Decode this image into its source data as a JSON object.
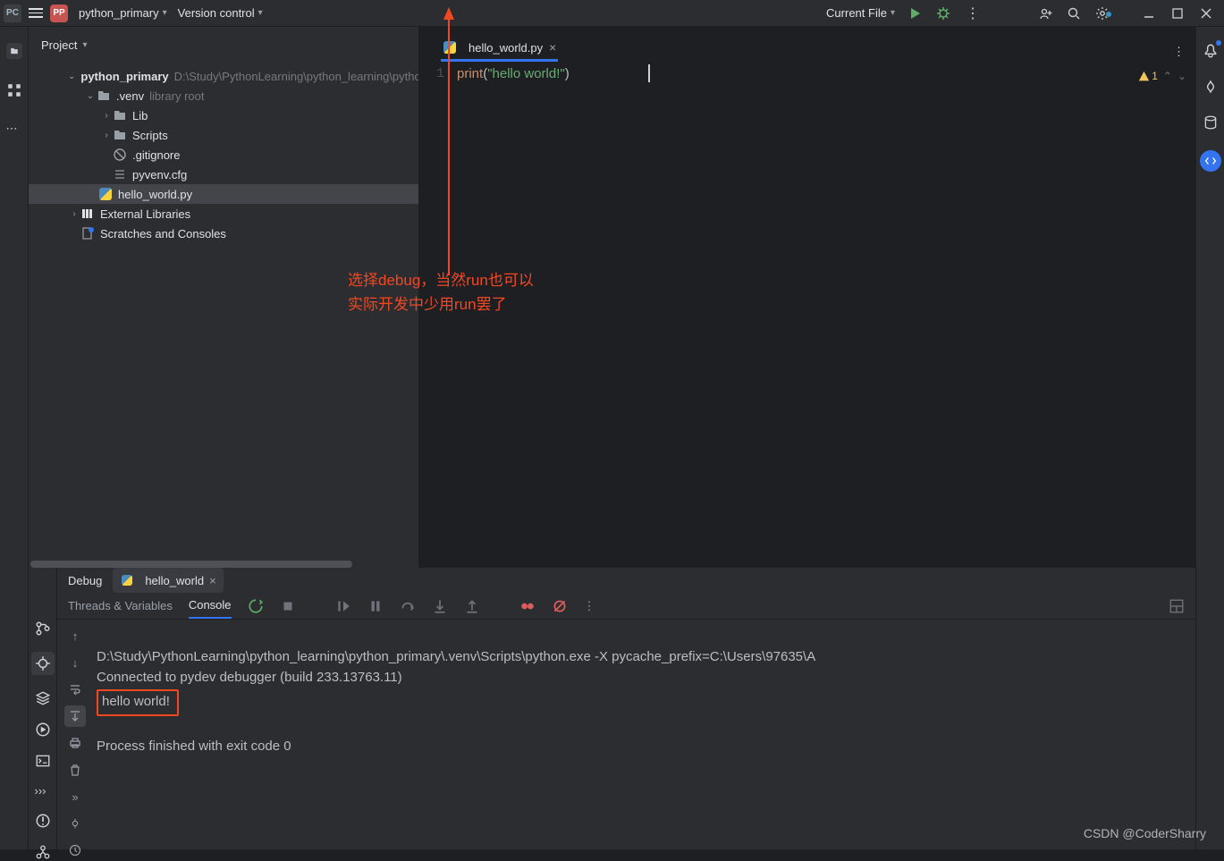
{
  "topbar": {
    "project_badge": "PP",
    "project_name": "python_primary",
    "version_control": "Version control",
    "run_config": "Current File"
  },
  "project_panel": {
    "title": "Project"
  },
  "tree": {
    "root": {
      "name": "python_primary",
      "path": "D:\\Study\\PythonLearning\\python_learning\\pytho"
    },
    "venv": {
      "name": ".venv",
      "tag": "library root"
    },
    "lib": "Lib",
    "scripts": "Scripts",
    "gitignore": ".gitignore",
    "pyvenv": "pyvenv.cfg",
    "hello": "hello_world.py",
    "ext_libs": "External Libraries",
    "scratches": "Scratches and Consoles"
  },
  "editor": {
    "tab": "hello_world.py",
    "line_number": "1",
    "code": {
      "fn": "print",
      "open": "(",
      "string": "\"hello world!\"",
      "close": ")"
    },
    "warnings": "1"
  },
  "annotation": {
    "line1": "选择debug，当然run也可以",
    "line2": "实际开发中少用run罢了"
  },
  "debug": {
    "title": "Debug",
    "tab": "hello_world",
    "tab_threads": "Threads & Variables",
    "tab_console": "Console"
  },
  "console": {
    "l1": "D:\\Study\\PythonLearning\\python_learning\\python_primary\\.venv\\Scripts\\python.exe -X pycache_prefix=C:\\Users\\97635\\A",
    "l2": "Connected to pydev debugger (build 233.13763.11)",
    "l3": "hello world!",
    "l4": "Process finished with exit code 0"
  },
  "watermark": "CSDN @CoderSharry"
}
